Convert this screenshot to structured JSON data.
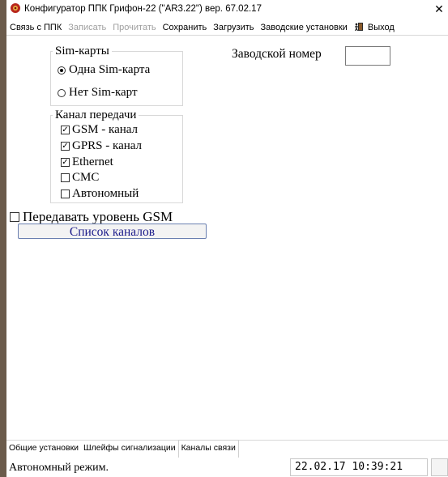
{
  "window": {
    "title": "Конфигуратор ППК Грифон-22 (\"AR3.22\") вер. 67.02.17",
    "close_label": "✕"
  },
  "menu": {
    "items": [
      {
        "label": "Связь с ППК",
        "enabled": true
      },
      {
        "label": "Записать",
        "enabled": false
      },
      {
        "label": "Прочитать",
        "enabled": false
      },
      {
        "label": "Сохранить",
        "enabled": true
      },
      {
        "label": "Загрузить",
        "enabled": true
      },
      {
        "label": "Заводские установки",
        "enabled": true
      }
    ],
    "exit_label": "Выход"
  },
  "sim": {
    "legend": "Sim-карты",
    "options": [
      {
        "label": "Одна Sim-карта",
        "selected": true
      },
      {
        "label": "Нет Sim-карт",
        "selected": false
      }
    ]
  },
  "factory": {
    "label": "Заводской номер",
    "value": ""
  },
  "channel": {
    "legend": "Канал передачи",
    "items": [
      {
        "label": "GSM - канал",
        "checked": true
      },
      {
        "label": "GPRS - канал",
        "checked": true
      },
      {
        "label": "Ethernet",
        "checked": true
      },
      {
        "label": "СМС",
        "checked": false
      },
      {
        "label": "Автономный",
        "checked": false
      }
    ]
  },
  "gsm_level": {
    "label": "Передавать уровень GSM",
    "checked": false
  },
  "channel_list_button": "Список каналов",
  "tabs": [
    {
      "label": "Общие установки",
      "active": false
    },
    {
      "label": "Шлейфы сигнализации",
      "active": false
    },
    {
      "label": "Каналы связи",
      "active": true
    }
  ],
  "status": {
    "text": "Автономный режим.",
    "datetime": "22.02.17  10:39:21"
  },
  "icons": {
    "app": "app-icon",
    "exit": "exit-icon"
  }
}
